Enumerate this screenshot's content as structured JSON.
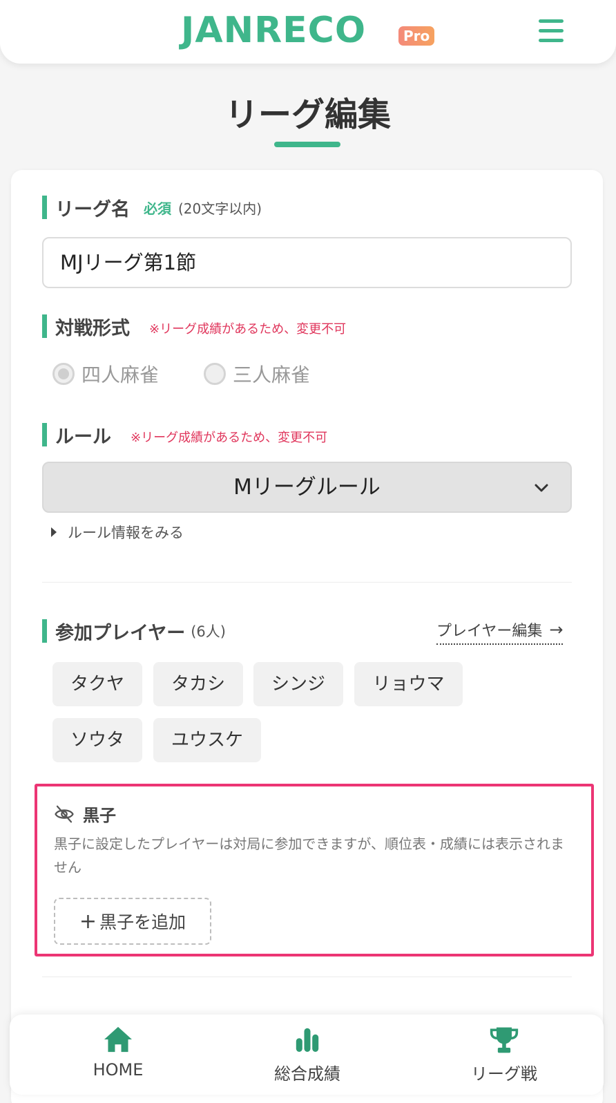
{
  "header": {
    "logo": "JANRECO",
    "badge": "Pro",
    "menu_icon": "hamburger-icon"
  },
  "page": {
    "title": "リーグ編集"
  },
  "league_name": {
    "label": "リーグ名",
    "required": "必須",
    "hint": "(20文字以内)",
    "value": "MJリーグ第1節"
  },
  "match_format": {
    "label": "対戦形式",
    "warning": "※リーグ成績があるため、変更不可",
    "options": [
      "四人麻雀",
      "三人麻雀"
    ],
    "selected": "四人麻雀"
  },
  "rule": {
    "label": "ルール",
    "warning": "※リーグ成績があるため、変更不可",
    "selected": "Mリーグルール",
    "info_link": "ルール情報をみる"
  },
  "players": {
    "label": "参加プレイヤー",
    "count": "(6人)",
    "edit_link": "プレイヤー編集",
    "list": [
      "タクヤ",
      "タカシ",
      "シンジ",
      "リョウマ",
      "ソウタ",
      "ユウスケ"
    ]
  },
  "kuroko": {
    "title": "黒子",
    "description": "黒子に設定したプレイヤーは対局に参加できますが、順位表・成績には表示されません",
    "add_button": "黒子を追加",
    "icon": "eye-slash-icon"
  },
  "bottom_nav": {
    "items": [
      {
        "label": "HOME",
        "icon": "home-icon"
      },
      {
        "label": "総合成績",
        "icon": "bar-chart-icon"
      },
      {
        "label": "リーグ戦",
        "icon": "trophy-icon"
      }
    ]
  },
  "colors": {
    "accent": "#3fb68b",
    "warning": "#e0365c",
    "highlight_border": "#ec3574"
  }
}
